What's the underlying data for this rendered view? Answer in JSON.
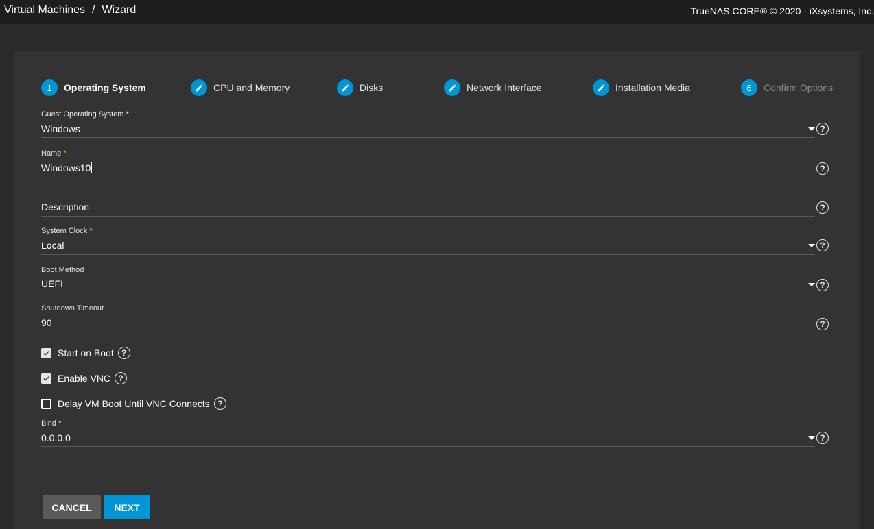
{
  "header": {
    "breadcrumb": [
      "Virtual Machines",
      "Wizard"
    ],
    "separator": "/",
    "copyright": "TrueNAS CORE® © 2020 - iXsystems, Inc."
  },
  "stepper": {
    "steps": [
      {
        "marker": "1",
        "label": "Operating System",
        "state": "active"
      },
      {
        "marker": "edit",
        "label": "CPU and Memory",
        "state": "edit"
      },
      {
        "marker": "edit",
        "label": "Disks",
        "state": "edit"
      },
      {
        "marker": "edit",
        "label": "Network Interface",
        "state": "edit"
      },
      {
        "marker": "edit",
        "label": "Installation Media",
        "state": "edit"
      },
      {
        "marker": "6",
        "label": "Confirm Options",
        "state": "disabled"
      }
    ]
  },
  "form": {
    "guest_os": {
      "label": "Guest Operating System",
      "required": "*",
      "value": "Windows"
    },
    "name": {
      "label": "Name",
      "required": "*",
      "value": "Windows10"
    },
    "description": {
      "placeholder": "Description",
      "value": ""
    },
    "system_clock": {
      "label": "System Clock",
      "required": "*",
      "value": "Local"
    },
    "boot_method": {
      "label": "Boot Method",
      "value": "UEFI"
    },
    "shutdown_timeout": {
      "label": "Shutdown Timeout",
      "value": "90"
    },
    "start_on_boot": {
      "label": "Start on Boot",
      "checked": true
    },
    "enable_vnc": {
      "label": "Enable VNC",
      "checked": true
    },
    "delay_vm_boot": {
      "label": "Delay VM Boot Until VNC Connects",
      "checked": false
    },
    "bind": {
      "label": "Bind",
      "required": "*",
      "value": "0.0.0.0"
    }
  },
  "buttons": {
    "cancel": "CANCEL",
    "next": "NEXT"
  },
  "icons": {
    "help": "help-circle-icon",
    "edit": "pencil-icon",
    "dropdown": "caret-down-icon",
    "check": "check-icon"
  },
  "colors": {
    "accent": "#0095d5",
    "background": "#2a2a2a",
    "card": "#333333",
    "topbar": "#1e1e1e",
    "required_highlight": "#d4b106"
  }
}
